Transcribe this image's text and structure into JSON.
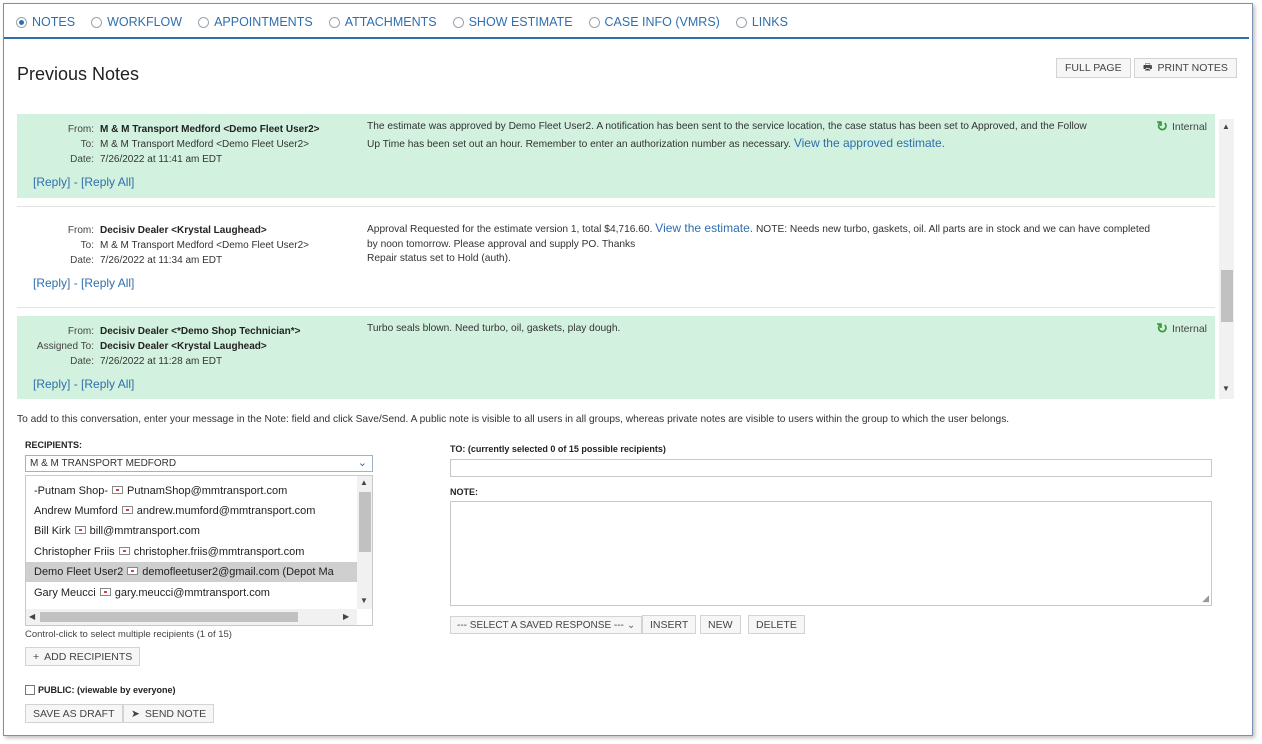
{
  "tabs": [
    {
      "label": "NOTES",
      "selected": true
    },
    {
      "label": "WORKFLOW",
      "selected": false
    },
    {
      "label": "APPOINTMENTS",
      "selected": false
    },
    {
      "label": "ATTACHMENTS",
      "selected": false
    },
    {
      "label": "SHOW ESTIMATE",
      "selected": false
    },
    {
      "label": "CASE INFO (VMRS)",
      "selected": false
    },
    {
      "label": "LINKS",
      "selected": false
    }
  ],
  "header": {
    "title": "Previous Notes",
    "full_page": "FULL PAGE",
    "print_notes": "PRINT NOTES"
  },
  "notes": [
    {
      "from_label": "From:",
      "from": "M & M Transport Medford <Demo Fleet User2>",
      "to_label": "To:",
      "to": "M & M Transport Medford <Demo Fleet User2>",
      "date_label": "Date:",
      "date": "7/26/2022 at 11:41 am EDT",
      "body1": "The estimate was approved by Demo Fleet User2. A notification has been sent to the service location, the case status has been set to Approved, and the Follow",
      "body2": "Up Time has been set out an hour. Remember to enter an authorization number as necessary.",
      "link": "View the approved estimate.",
      "internal": "Internal",
      "reply": "[Reply]",
      "reply_sep": " - ",
      "reply_all": "[Reply All]"
    },
    {
      "from_label": "From:",
      "from": "Decisiv Dealer <Krystal Laughead>",
      "to_label": "To:",
      "to": "M & M Transport Medford <Demo Fleet User2>",
      "date_label": "Date:",
      "date": "7/26/2022 at 11:34 am EDT",
      "body_pre": "Approval Requested for the estimate version 1, total $4,716.60.",
      "link": "View the estimate.",
      "body_post": "NOTE: Needs new turbo, gaskets, oil. All parts are in stock and we can have completed",
      "body2": "by noon tomorrow. Please approval and supply PO. Thanks",
      "body3": "Repair status set to Hold (auth).",
      "reply": "[Reply]",
      "reply_sep": " - ",
      "reply_all": "[Reply All]"
    },
    {
      "from_label": "From:",
      "from": "Decisiv Dealer <*Demo Shop Technician*>",
      "to_label": "Assigned To:",
      "to": "Decisiv Dealer <Krystal Laughead>",
      "date_label": "Date:",
      "date": "7/26/2022 at 11:28 am EDT",
      "body1": "Turbo seals blown. Need turbo, oil, gaskets, play dough.",
      "internal": "Internal",
      "reply": "[Reply]",
      "reply_sep": " - ",
      "reply_all": "[Reply All]"
    }
  ],
  "instructions": "To add to this conversation, enter your message in the Note: field and click Save/Send. A public note is visible to all users in all groups, whereas private notes are visible to users within the group to which the user belongs.",
  "recipients": {
    "label": "RECIPIENTS:",
    "group": "M & M TRANSPORT MEDFORD",
    "items": [
      {
        "name": "-Putnam Shop-",
        "email": "PutnamShop@mmtransport.com"
      },
      {
        "name": "Andrew Mumford",
        "email": "andrew.mumford@mmtransport.com"
      },
      {
        "name": "Bill Kirk",
        "email": "bill@mmtransport.com"
      },
      {
        "name": "Christopher Friis",
        "email": "christopher.friis@mmtransport.com"
      },
      {
        "name": "Demo Fleet User2",
        "email": "demofleetuser2@gmail.com (Depot Ma",
        "selected": true
      },
      {
        "name": "Gary Meucci",
        "email": "gary.meucci@mmtransport.com"
      }
    ],
    "hint": "Control-click to select multiple recipients (1 of 15)",
    "add_button": "ADD RECIPIENTS"
  },
  "compose": {
    "to_label": "TO: (currently selected 0 of 15 possible recipients)",
    "note_label": "NOTE:",
    "saved_response": "--- SELECT A SAVED RESPONSE ---",
    "insert": "INSERT",
    "new": "NEW",
    "delete": "DELETE"
  },
  "footer": {
    "public_label": "PUBLIC: (viewable by everyone)",
    "save_draft": "SAVE AS DRAFT",
    "send_note": "SEND NOTE"
  }
}
